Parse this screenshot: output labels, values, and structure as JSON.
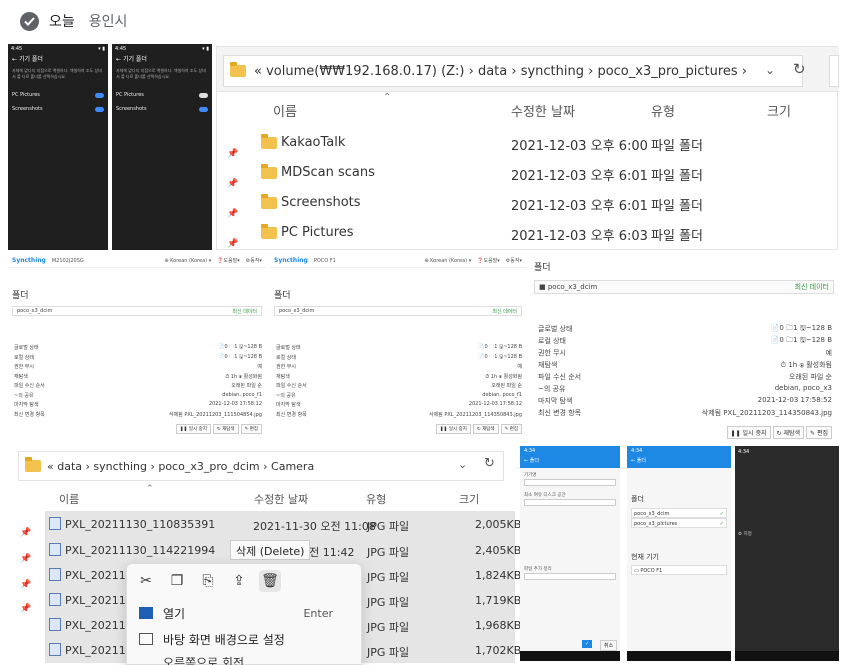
{
  "header": {
    "title": "오늘",
    "subtitle": "용인시"
  },
  "phones": [
    {
      "status": "4:45",
      "title": "기기 폴더",
      "desc": "자체에 없다지 지점으로 액셀하다. 액셀하여 조도 상대서 폴 더로 폴더를 선택하십시요.",
      "items": [
        {
          "label": "PC Pictures",
          "toggle": "on"
        },
        {
          "label": "Screenshots",
          "toggle": "on"
        }
      ]
    },
    {
      "status": "4:45",
      "title": "기기 폴더",
      "desc": "자체에 없다지 지점으로 액셀하다. 액셀하여 조도 상대서 폴 더로 폴더를 선택하십시요.",
      "items": [
        {
          "label": "PC Pictures",
          "toggle": "off"
        },
        {
          "label": "Screenshots",
          "toggle": "on"
        }
      ]
    }
  ],
  "explorer1": {
    "path": "«  volume(₩₩192.168.0.17) (Z:)  ›  data  ›  syncthing  ›  poco_x3_pro_pictures  ›",
    "columns": {
      "name": "이름",
      "modified": "수정한 날짜",
      "type": "유형",
      "size": "크기"
    },
    "rows": [
      {
        "name": "KakaoTalk",
        "modified": "2021-12-03 오후 6:00",
        "type": "파일 폴더"
      },
      {
        "name": "MDScan scans",
        "modified": "2021-12-03 오후 6:01",
        "type": "파일 폴더"
      },
      {
        "name": "Screenshots",
        "modified": "2021-12-03 오후 6:01",
        "type": "파일 폴더"
      },
      {
        "name": "PC Pictures",
        "modified": "2021-12-03 오후 6:03",
        "type": "파일 폴더"
      }
    ]
  },
  "sync": {
    "logo": "Syncthing",
    "panels": [
      {
        "device": "M2102J20SG",
        "lang": "Korean (Korea)",
        "help": "도움말",
        "action": "동작"
      },
      {
        "device": "POCO F1",
        "lang": "Korean (Korea)",
        "help": "도움말",
        "action": "동작"
      }
    ],
    "folder_label": "폴더",
    "folder_name_a": "poco_x3_dcim",
    "folder_name_b": "poco_x3_dcim",
    "folder_status": "최신 데이터",
    "labels": [
      "글로벌 상태",
      "로컬 상태",
      "권한 무시",
      "재탐색",
      "파일 수신 순서",
      "~의 공유",
      "마지막 탐색",
      "최신 변경 항목"
    ],
    "values_a": [
      "📄0  🗀1  🖫~128 B",
      "📄0  🗀1  🖫~128 B",
      "예",
      "⏱ 1h  ⦿ 활성화됨",
      "오래된 파일 순",
      "debian, poco_f1",
      "2021-12-03 17:58:12",
      "삭제됨 PXL_20211203_111504854.jpg"
    ],
    "values_b": [
      "📄0  🗀1  🖫~128 B",
      "📄0  🗀1  🖫~128 B",
      "예",
      "⏱ 1h  ⦿ 활성화됨",
      "오래된 파일 순",
      "debian, poco_f1",
      "2021-12-03 17:58:12",
      "삭제됨 PXL_20211203_114350843.jpg"
    ],
    "values_c": [
      "📄0  🗀1  🖫~128 B",
      "📄0  🗀1  🖫~128 B",
      "예",
      "⏱ 1h  ⦿ 활성화됨",
      "오래된 파일 순",
      "debian, poco_x3",
      "2021-12-03 17:58:52",
      "삭제됨 PXL_20211203_114350843.jpg"
    ],
    "buttons": [
      "일시 중지",
      "재탐색",
      "편집"
    ]
  },
  "explorer2": {
    "path": "«  data  ›  syncthing  ›  poco_x3_pro_dcim  ›  Camera",
    "columns": {
      "name": "이름",
      "modified": "수정한 날짜",
      "type": "유형",
      "size": "크기"
    },
    "rows": [
      {
        "name": "PXL_20211130_110835391",
        "modified": "2021-11-30 오전 11:08",
        "type": "JPG 파일",
        "size": "2,005KB"
      },
      {
        "name": "PXL_20211130_114221994",
        "modified": "오전 11:42",
        "type": "JPG 파일",
        "size": "2,405KB"
      },
      {
        "name": "PXL_20211130",
        "modified": "",
        "type": "JPG 파일",
        "size": "1,824KB"
      },
      {
        "name": "PXL_20211201",
        "modified": "",
        "type": "JPG 파일",
        "size": "1,719KB"
      },
      {
        "name": "PXL_20211201",
        "modified": "",
        "type": "JPG 파일",
        "size": "1,968KB"
      },
      {
        "name": "PXL_20211201",
        "modified": "",
        "type": "JPG 파일",
        "size": "1,702KB"
      }
    ]
  },
  "context": {
    "tooltip": "삭제 (Delete)",
    "open": "열기",
    "open_key": "Enter",
    "set_bg": "바탕 화면 배경으로 설정",
    "cut_partial": "오른쪽으로 회전"
  },
  "android": {
    "a": {
      "time": "4:34",
      "title": "폴더",
      "folder_label": "폴더",
      "items": [
        "poco_x3_dcim",
        "poco_x3_pictures"
      ],
      "device_label": "현재 기기",
      "device": "POCO F1",
      "btn": "취소"
    },
    "b": {
      "time": "4:34",
      "title": "폴더",
      "folder_label": "폴더",
      "items": [
        "poco_x3_dcim",
        "poco_x3_pictures"
      ],
      "device_label": "현재 기기",
      "device": "POCO F1"
    },
    "c": {
      "time": "4:34",
      "menu": [
        "지정"
      ]
    }
  }
}
